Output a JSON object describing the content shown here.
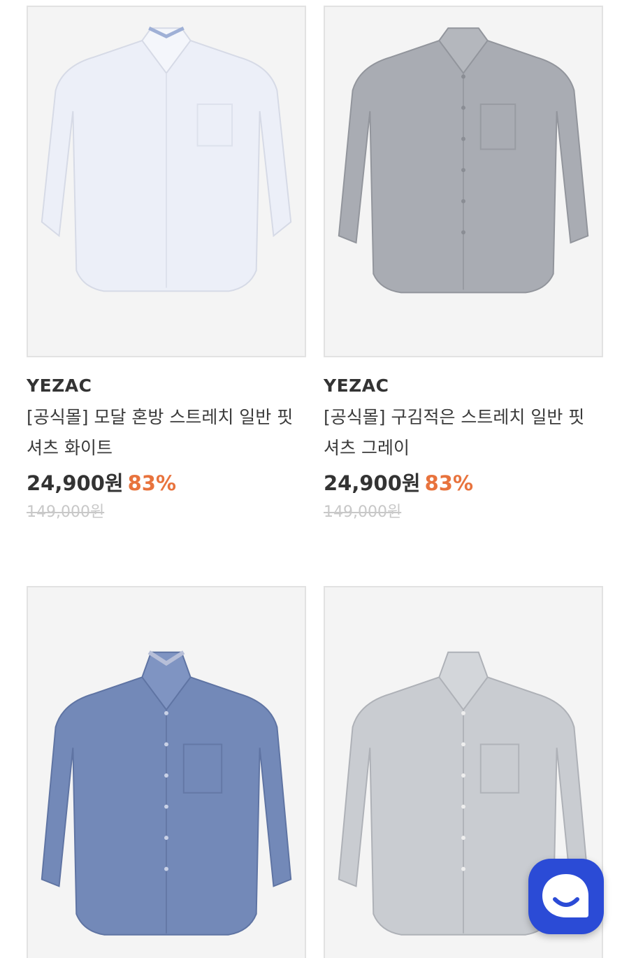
{
  "products": [
    {
      "brand": "YEZAC",
      "title": "[공식몰] 모달 혼방 스트레치 일반 핏 셔츠 화이트",
      "price": "24,900원",
      "discount": "83%",
      "original_price": "149,000원",
      "image_icon": "white-shirt-image",
      "shirt_color": "#eceff8"
    },
    {
      "brand": "YEZAC",
      "title": "[공식몰] 구김적은 스트레치 일반 핏 셔츠 그레이",
      "price": "24,900원",
      "discount": "83%",
      "original_price": "149,000원",
      "image_icon": "gray-shirt-image",
      "shirt_color": "#a9acb3"
    },
    {
      "image_icon": "blue-shirt-image",
      "shirt_color": "#7389b8"
    },
    {
      "image_icon": "striped-gray-shirt-image",
      "shirt_color": "#c9ccd1"
    }
  ],
  "chat_button": {
    "icon": "chat-smile-icon",
    "color": "#2b4bd6"
  },
  "colors": {
    "discount": "#e8733d",
    "original_price": "#c8c8c8"
  }
}
